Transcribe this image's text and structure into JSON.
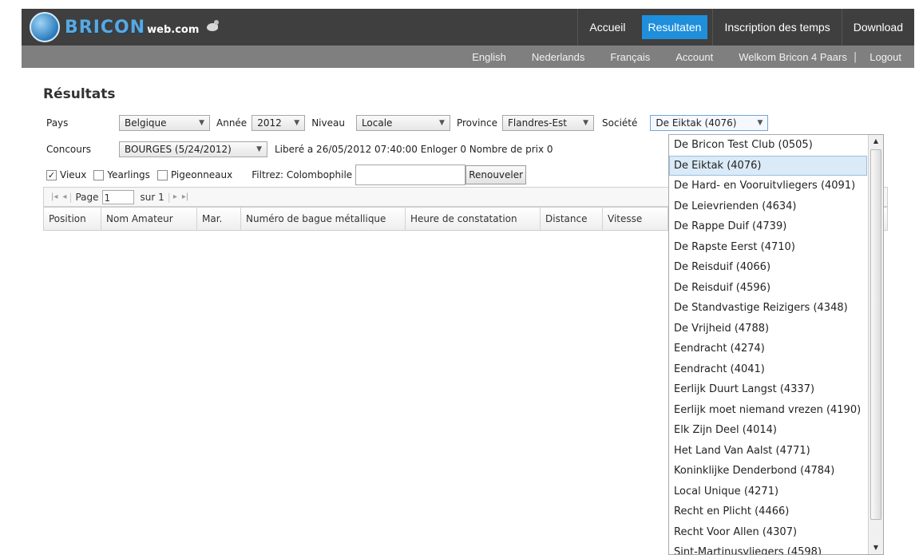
{
  "header": {
    "logo_text": "BRICON",
    "logo_small": "web.com",
    "nav": [
      "Accueil",
      "Resultaten",
      "Inscription des temps",
      "Download"
    ],
    "active_nav": "Resultaten",
    "subnav": [
      "English",
      "Nederlands",
      "Français",
      "Account",
      "Welkom Bricon 4 Paars",
      "|",
      "Logout"
    ]
  },
  "page_title": "Résultats",
  "filters": {
    "pays_label": "Pays",
    "pays_value": "Belgique",
    "annee_label": "Année",
    "annee_value": "2012",
    "niveau_label": "Niveau",
    "niveau_value": "Locale",
    "province_label": "Province",
    "province_value": "Flandres-Est",
    "societe_label": "Société",
    "societe_value": "De Eiktak (4076)",
    "concours_label": "Concours",
    "concours_value": "BOURGES (5/24/2012)",
    "libere_text": "Liberé a  26/05/2012 07:40:00  Enloger  0  Nombre de prix  0",
    "vieux_label": "Vieux",
    "yearlings_label": "Yearlings",
    "pigeonneaux_label": "Pigeonneaux",
    "filtrez_label": "Filtrez: Colombophile",
    "filter_value": "",
    "renew_button": "Renouveler"
  },
  "pager": {
    "first": "|◂",
    "prev": "◂",
    "page_label": "Page",
    "page_value": "1",
    "of_text": "sur 1",
    "next": "▸",
    "last": "▸|"
  },
  "grid": {
    "columns": [
      "Position",
      "Nom Amateur",
      "Mar.",
      "Numéro de bague métallique",
      "Heure de constatation",
      "Distance",
      "Vitesse"
    ]
  },
  "dropdown": {
    "selected": "De Eiktak (4076)",
    "options": [
      "De Bricon Test Club (0505)",
      "De Eiktak (4076)",
      "De Hard- en Vooruitvliegers (4091)",
      "De Leievrienden (4634)",
      "De Rappe Duif  (4739)",
      "De Rapste Eerst  (4710)",
      "De Reisduif  (4066)",
      "De Reisduif  (4596)",
      "De Standvastige Reizigers  (4348)",
      "De Vrijheid  (4788)",
      "Eendracht  (4274)",
      "Eendracht  (4041)",
      "Eerlijk Duurt Langst (4337)",
      "Eerlijk moet niemand vrezen  (4190)",
      "Elk Zijn Deel (4014)",
      "Het Land Van Aalst (4771)",
      "Koninklijke Denderbond  (4784)",
      "Local Unique  (4271)",
      "Recht en Plicht  (4466)",
      "Recht Voor Allen (4307)",
      "Sint-Martinusvliegers  (4598)"
    ]
  }
}
